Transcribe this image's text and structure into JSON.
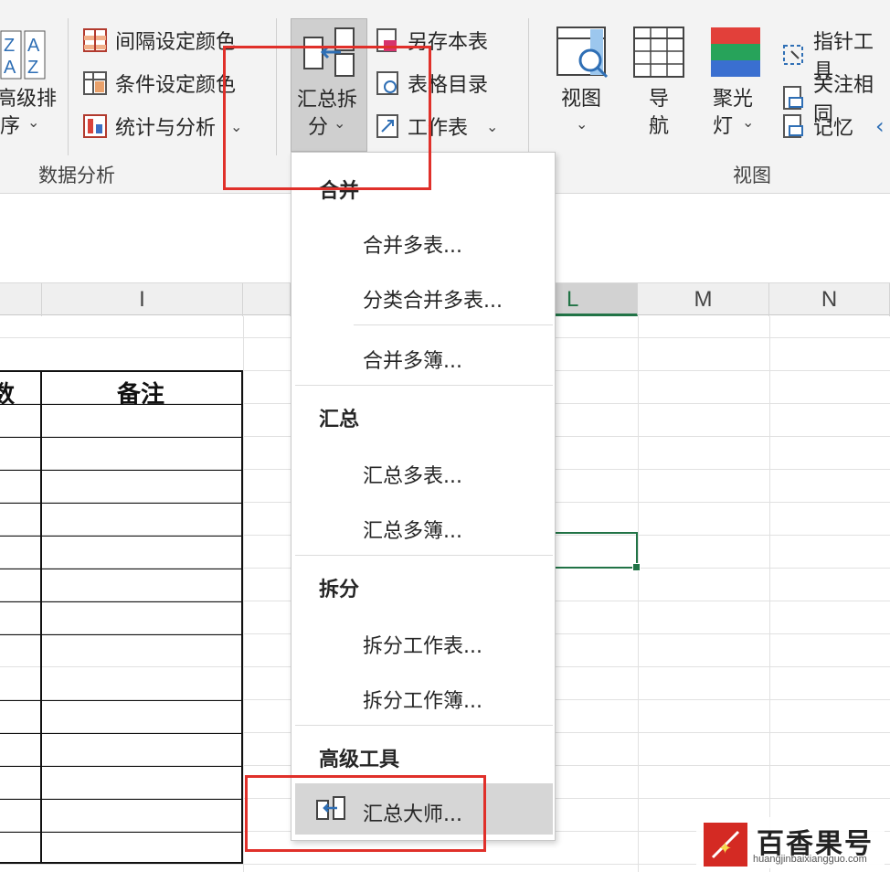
{
  "ribbon": {
    "sort_button": {
      "line1": "高级排",
      "line2": "序",
      "chevron": "⌄",
      "icon": "sort-az-icon"
    },
    "interval_color": {
      "label": "间隔设定颜色",
      "icon": "interval-grid-icon"
    },
    "condition_color": {
      "label": "条件设定颜色",
      "icon": "condition-grid-icon"
    },
    "stats_analysis": {
      "label": "统计与分析",
      "chevron": "⌄",
      "icon": "stats-icon"
    },
    "data_analysis_group": "数据分析",
    "merge_split": {
      "line1": "汇总拆",
      "line2": "分",
      "chevron": "⌄",
      "icon": "merge-split-icon"
    },
    "save_sheet": {
      "label": "另存本表",
      "icon": "save-sheet-icon"
    },
    "table_directory": {
      "label": "表格目录",
      "icon": "table-dir-icon"
    },
    "worksheet": {
      "label": "工作表",
      "chevron": "⌄",
      "icon": "worksheet-icon"
    },
    "view_button": {
      "line1": "视图",
      "chevron": "⌄",
      "icon": "view-magnifier-icon"
    },
    "nav_button": {
      "line1": "导",
      "line2": "航",
      "icon": "grid-nav-icon"
    },
    "spotlight_button": {
      "line1": "聚光",
      "line2": "灯",
      "chevron": "⌄",
      "icon": "spotlight-icon"
    },
    "pointer_tool": {
      "label": "指针工具",
      "icon": "pointer-tool-icon"
    },
    "focus_related": {
      "label": "关注相同",
      "icon": "focus-icon"
    },
    "memory": {
      "label": "记忆",
      "icon": "memory-icon"
    },
    "view_group": "视图"
  },
  "sheet": {
    "columns": [
      "I",
      "L",
      "M",
      "N"
    ],
    "table_header_partial": "数",
    "table_header_notes": "备注"
  },
  "dropdown": {
    "sections": [
      {
        "header": "合并",
        "items": [
          "合并多表...",
          "分类合并多表...",
          "合并多簿..."
        ]
      },
      {
        "header": "汇总",
        "items": [
          "汇总多表...",
          "汇总多簿..."
        ]
      },
      {
        "header": "拆分",
        "items": [
          "拆分工作表...",
          "拆分工作簿..."
        ]
      },
      {
        "header": "高级工具",
        "items": [
          "汇总大师..."
        ]
      }
    ]
  },
  "watermark": {
    "title": "百香果号",
    "url": "huangjinbaixiangguo.com"
  },
  "colors": {
    "highlight": "#e0302a",
    "selection": "#217346",
    "ribbon_bg": "#f3f3f3"
  }
}
